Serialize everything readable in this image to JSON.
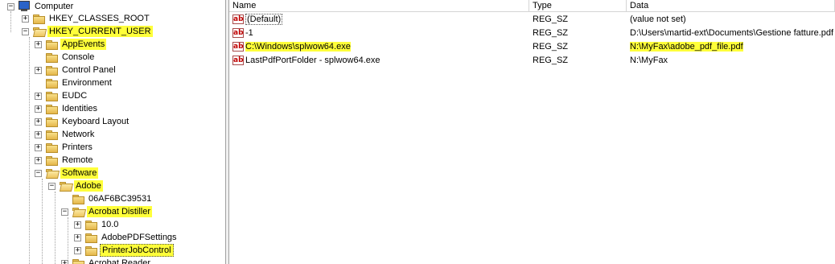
{
  "tree": {
    "computer": "Computer",
    "hkcr": "HKEY_CLASSES_ROOT",
    "hkcu": "HKEY_CURRENT_USER",
    "hkcu_children": [
      "AppEvents",
      "Console",
      "Control Panel",
      "Environment",
      "EUDC",
      "Identities",
      "Keyboard Layout",
      "Network",
      "Printers",
      "Remote",
      "Software"
    ],
    "adobe": "Adobe",
    "adobe_children": [
      "06AF6BC39531",
      "Acrobat Distiller"
    ],
    "distiller_children": [
      "10.0",
      "AdobePDFSettings",
      "PrinterJobControl"
    ],
    "acrobat_reader": "Acrobat Reader"
  },
  "list": {
    "columns": [
      "Name",
      "Type",
      "Data"
    ],
    "rows": [
      {
        "name": "(Default)",
        "type": "REG_SZ",
        "data": "(value not set)"
      },
      {
        "name": "-1",
        "type": "REG_SZ",
        "data": "D:\\Users\\martid-ext\\Documents\\Gestione fatture.pdf"
      },
      {
        "name": "C:\\Windows\\splwow64.exe",
        "type": "REG_SZ",
        "data": "N:\\MyFax\\adobe_pdf_file.pdf"
      },
      {
        "name": "LastPdfPortFolder - splwow64.exe",
        "type": "REG_SZ",
        "data": "N:\\MyFax"
      }
    ]
  },
  "icons": {
    "value": "string-value-icon",
    "folder": "folder-icon",
    "computer": "computer-icon"
  },
  "colors": {
    "highlight": "#ffff3a"
  }
}
